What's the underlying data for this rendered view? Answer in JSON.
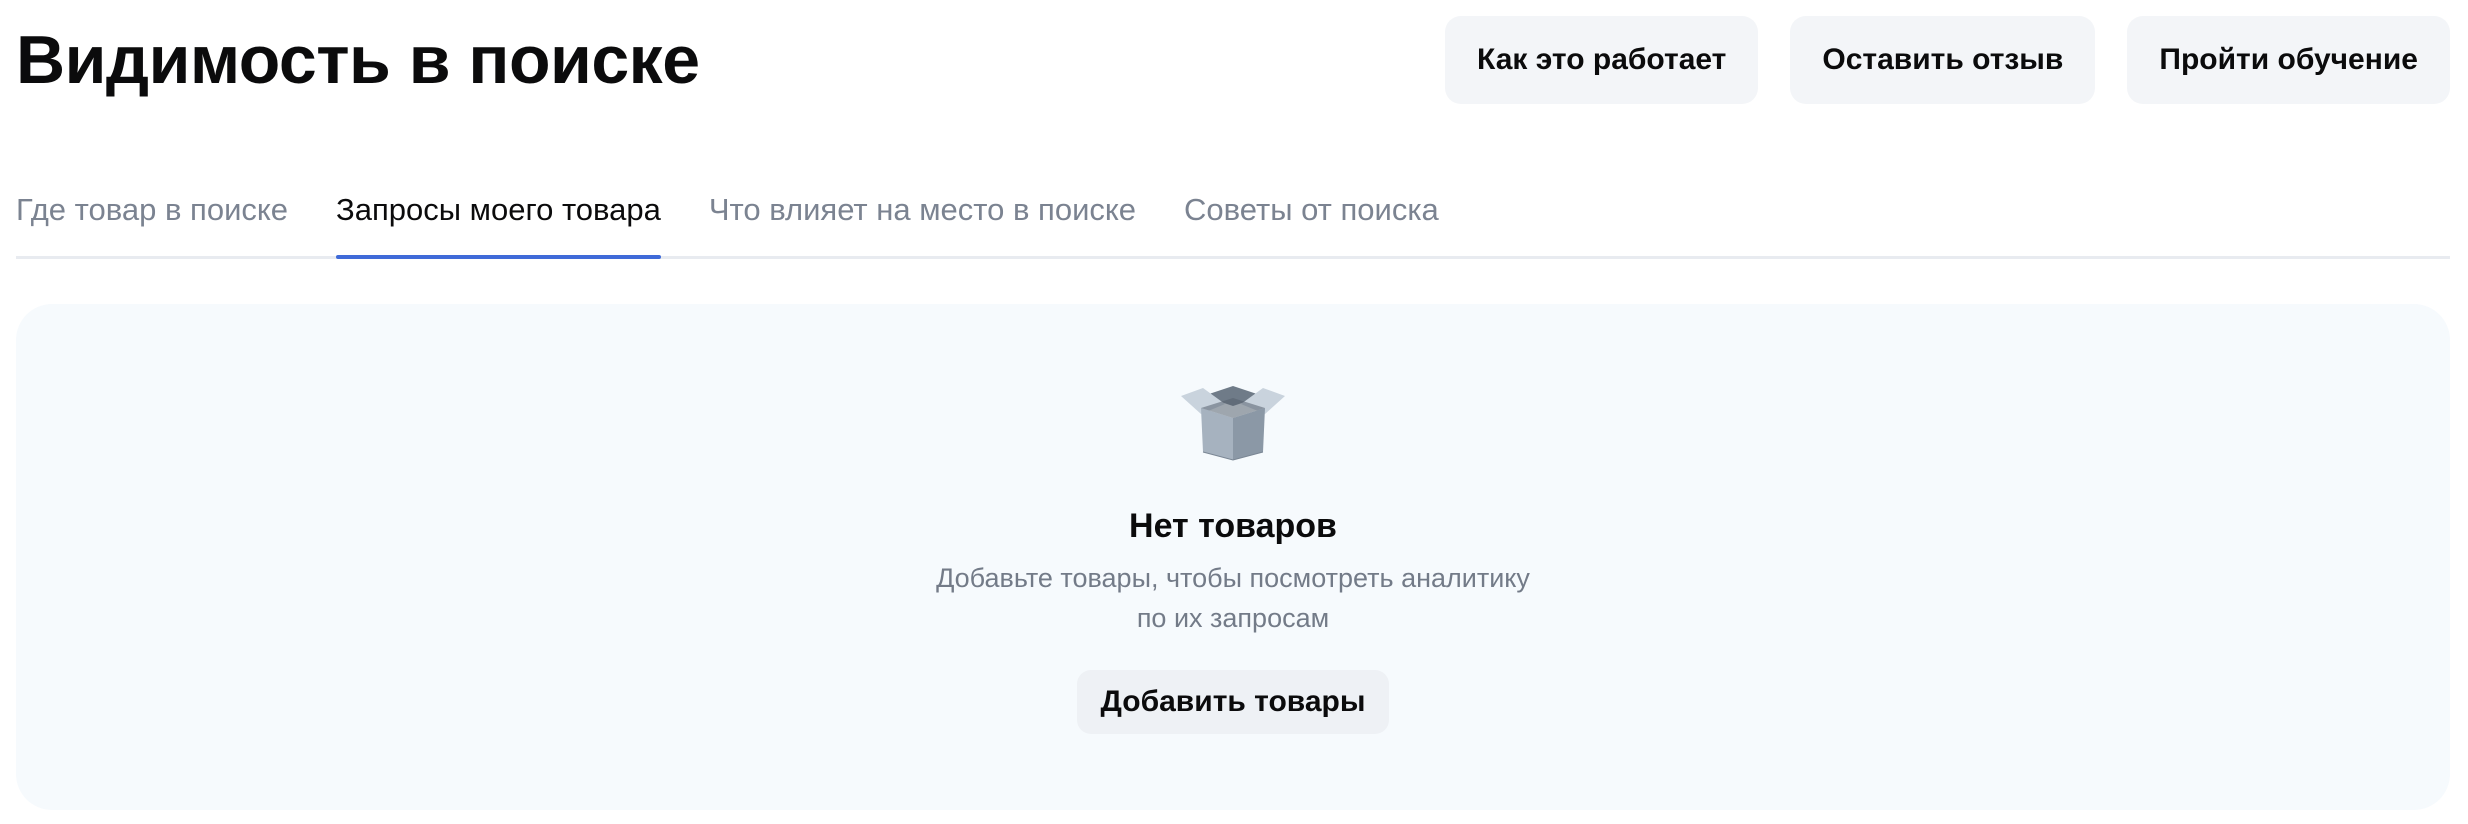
{
  "header": {
    "title": "Видимость в поиске",
    "actions": [
      {
        "label": "Как это работает"
      },
      {
        "label": "Оставить отзыв"
      },
      {
        "label": "Пройти обучение"
      }
    ]
  },
  "tabs": [
    {
      "label": "Где товар в поиске",
      "active": false
    },
    {
      "label": "Запросы моего товара",
      "active": true
    },
    {
      "label": "Что влияет на место в поиске",
      "active": false
    },
    {
      "label": "Советы от поиска",
      "active": false
    }
  ],
  "empty_state": {
    "icon": "box-icon",
    "title": "Нет товаров",
    "description_line1": "Добавьте товары, чтобы посмотреть аналитику",
    "description_line2": "по их запросам",
    "button_label": "Добавить товары"
  },
  "colors": {
    "accent": "#3f6ad8",
    "panel_bg": "#f6fafd",
    "button_bg": "#f3f5f8",
    "muted_text": "#7b8391"
  }
}
